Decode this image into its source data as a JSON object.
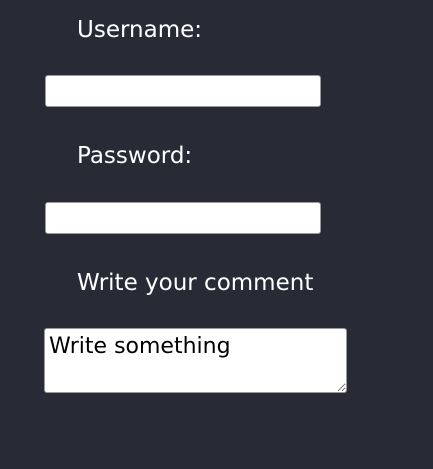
{
  "form": {
    "username": {
      "label": "Username:",
      "value": "",
      "placeholder": ""
    },
    "password": {
      "label": "Password:",
      "value": "",
      "placeholder": ""
    },
    "comment": {
      "label": "Write your comment",
      "value": "",
      "placeholder": "Write something"
    }
  },
  "colors": {
    "background": "#282a36",
    "label_text": "#ffffff",
    "field_background": "#ffffff"
  }
}
